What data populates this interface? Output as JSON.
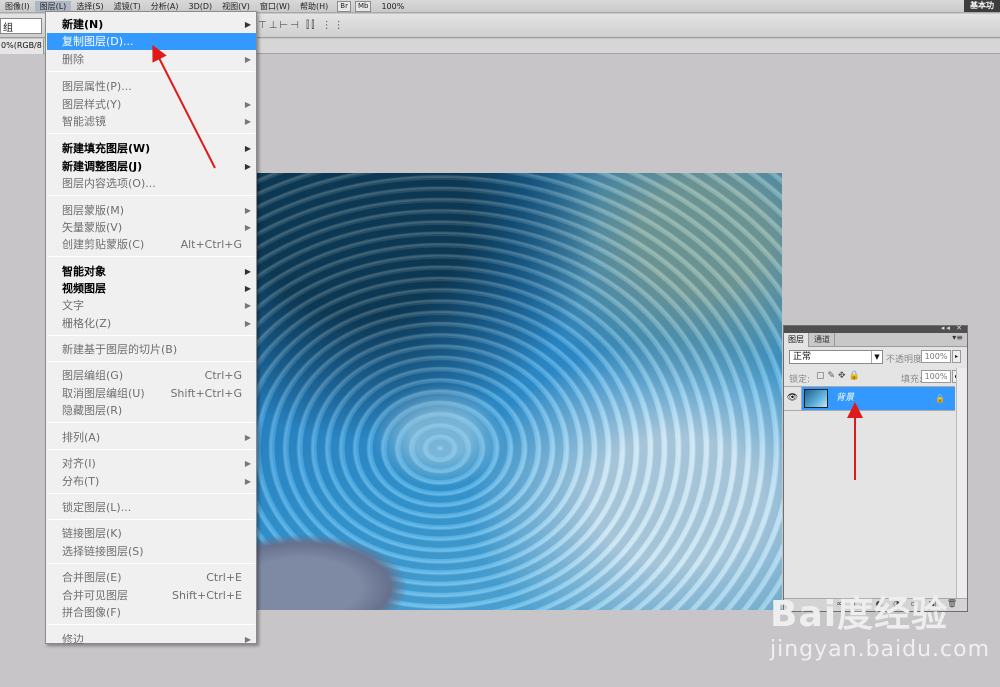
{
  "menubar": {
    "items": [
      "图像(I)",
      "图层(L)",
      "选择(S)",
      "滤镜(T)",
      "分析(A)",
      "3D(D)",
      "视图(V)",
      "窗口(W)",
      "帮助(H)"
    ],
    "buttons": [
      "Br",
      "Mb"
    ],
    "zoom": "100%",
    "workspace": "基本功"
  },
  "optbar": {
    "preset": "组"
  },
  "doctab": {
    "label": "0%(RGB/8"
  },
  "menu": {
    "items": [
      {
        "label": "新建(N)",
        "arrow": true,
        "style": "bold"
      },
      {
        "label": "复制图层(D)...",
        "style": "sel"
      },
      {
        "label": "删除",
        "arrow": true,
        "style": "dis"
      },
      {
        "label": "图层属性(P)...",
        "style": "dis"
      },
      {
        "label": "图层样式(Y)",
        "arrow": true,
        "style": "dis"
      },
      {
        "label": "智能滤镜",
        "arrow": true,
        "style": "dis"
      },
      {
        "label": "新建填充图层(W)",
        "arrow": true,
        "style": "bold"
      },
      {
        "label": "新建调整图层(J)",
        "arrow": true,
        "style": "bold"
      },
      {
        "label": "图层内容选项(O)...",
        "style": "dis"
      },
      {
        "label": "图层蒙版(M)",
        "arrow": true,
        "style": "dis"
      },
      {
        "label": "矢量蒙版(V)",
        "arrow": true,
        "style": "dis"
      },
      {
        "label": "创建剪贴蒙版(C)",
        "shortcut": "Alt+Ctrl+G",
        "style": "dis"
      },
      {
        "label": "智能对象",
        "arrow": true,
        "style": "bold"
      },
      {
        "label": "视频图层",
        "arrow": true,
        "style": "bold"
      },
      {
        "label": "文字",
        "arrow": true,
        "style": "dis"
      },
      {
        "label": "栅格化(Z)",
        "arrow": true,
        "style": "dis"
      },
      {
        "label": "新建基于图层的切片(B)",
        "style": "dis"
      },
      {
        "label": "图层编组(G)",
        "shortcut": "Ctrl+G",
        "style": "dis"
      },
      {
        "label": "取消图层编组(U)",
        "shortcut": "Shift+Ctrl+G",
        "style": "dis"
      },
      {
        "label": "隐藏图层(R)",
        "style": "dis"
      },
      {
        "label": "排列(A)",
        "arrow": true,
        "style": "dis"
      },
      {
        "label": "对齐(I)",
        "arrow": true,
        "style": "dis"
      },
      {
        "label": "分布(T)",
        "arrow": true,
        "style": "dis"
      },
      {
        "label": "锁定图层(L)...",
        "style": "dis"
      },
      {
        "label": "链接图层(K)",
        "style": "dis"
      },
      {
        "label": "选择链接图层(S)",
        "style": "dis"
      },
      {
        "label": "合并图层(E)",
        "shortcut": "Ctrl+E",
        "style": "dis"
      },
      {
        "label": "合并可见图层",
        "shortcut": "Shift+Ctrl+E",
        "style": "dis"
      },
      {
        "label": "拼合图像(F)",
        "style": "dis"
      },
      {
        "label": "修边",
        "arrow": true,
        "style": "dis"
      }
    ]
  },
  "layers_panel": {
    "tabs": [
      "图层",
      "通道"
    ],
    "blend_mode": "正常",
    "opacity_label": "不透明度:",
    "opacity_value": "100%",
    "lock_label": "锁定:",
    "fill_label": "填充:",
    "fill_value": "100%",
    "layer_name": "背景"
  },
  "watermark": {
    "logo": "Bai度经验",
    "url": "jingyan.baidu.com"
  },
  "colors": {
    "selection": "#3399ff",
    "arrow": "#e01a1a"
  }
}
